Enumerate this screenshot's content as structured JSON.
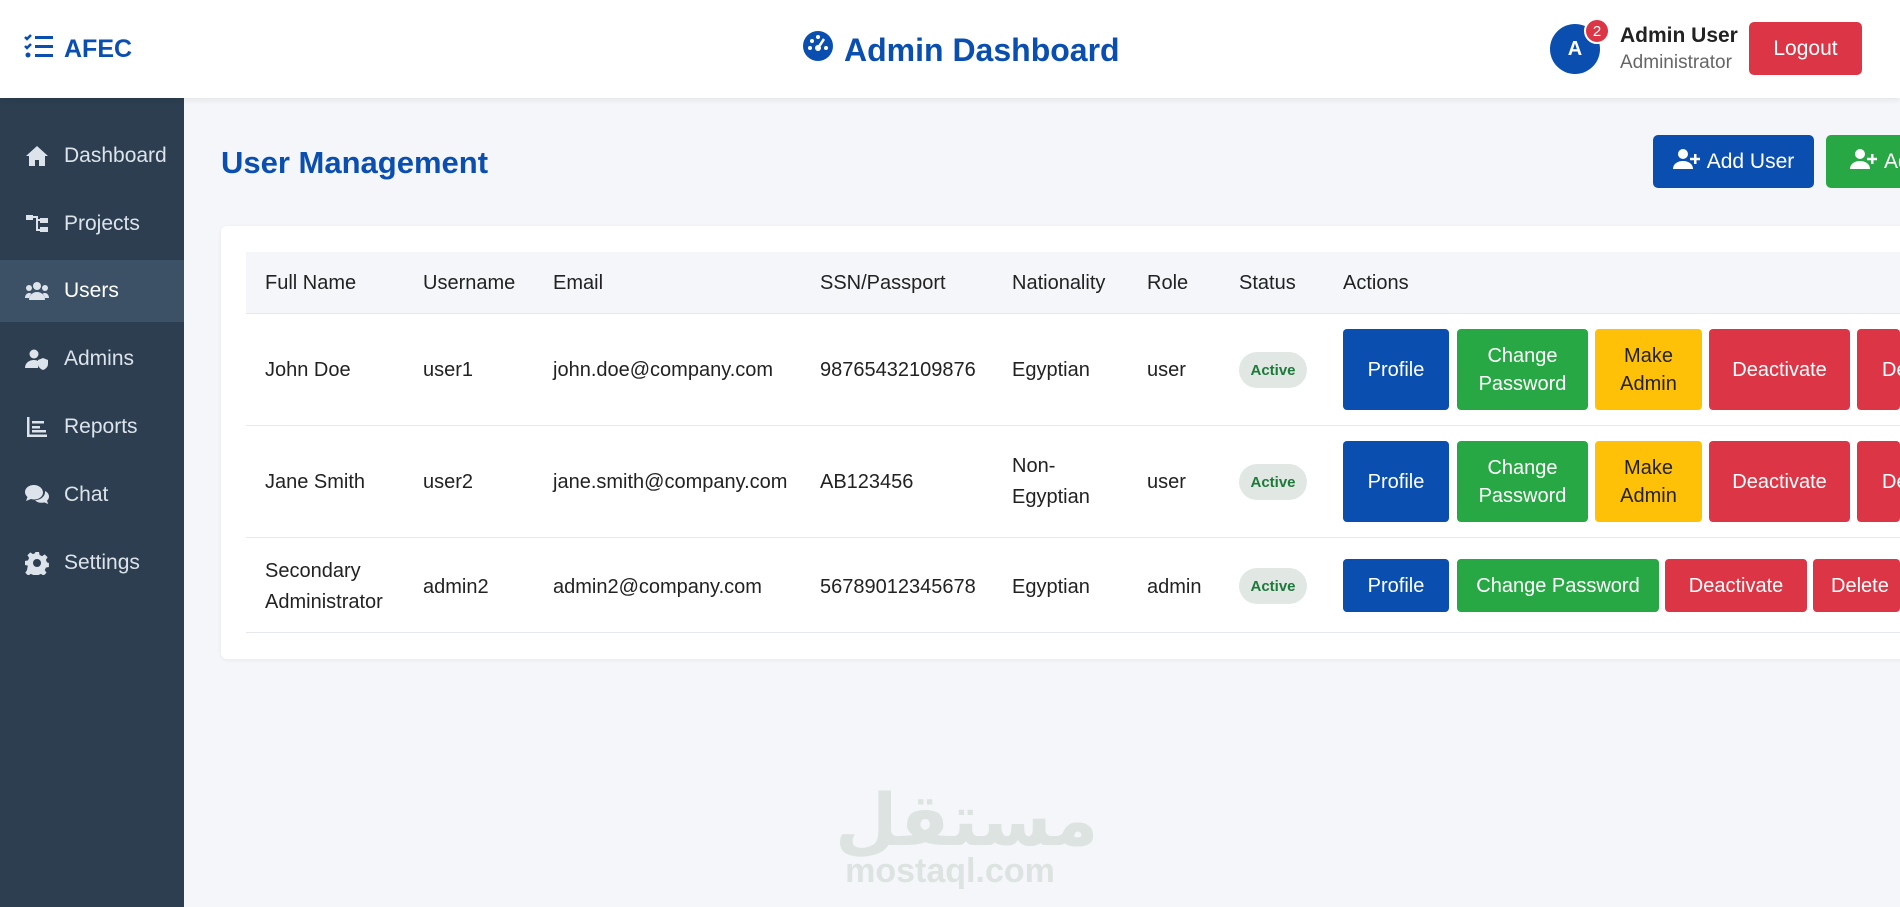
{
  "header": {
    "brand": "AFEC",
    "title": "Admin Dashboard",
    "avatar_initial": "A",
    "notification_count": "2",
    "user_name": "Admin User",
    "user_role": "Administrator",
    "logout_label": "Logout"
  },
  "sidebar": {
    "items": [
      {
        "label": "Dashboard",
        "icon": "home-icon"
      },
      {
        "label": "Projects",
        "icon": "sitemap-icon"
      },
      {
        "label": "Users",
        "icon": "users-icon",
        "active": true
      },
      {
        "label": "Admins",
        "icon": "user-shield-icon"
      },
      {
        "label": "Reports",
        "icon": "chart-icon"
      },
      {
        "label": "Chat",
        "icon": "comments-icon"
      },
      {
        "label": "Settings",
        "icon": "gear-icon"
      }
    ]
  },
  "main": {
    "title": "User Management",
    "add_user_label": "Add User",
    "add_admin_label": "Add Admin",
    "columns": [
      "Full Name",
      "Username",
      "Email",
      "SSN/Passport",
      "Nationality",
      "Role",
      "Status",
      "Actions"
    ],
    "rows": [
      {
        "full_name": "John Doe",
        "username": "user1",
        "email": "john.doe@company.com",
        "ssn": "98765432109876",
        "nationality": "Egyptian",
        "role": "user",
        "status": "Active",
        "actions": {
          "profile": "Profile",
          "change_password": "Change Password",
          "make_admin": "Make Admin",
          "deactivate": "Deactivate",
          "delete": "Delete"
        }
      },
      {
        "full_name": "Jane Smith",
        "username": "user2",
        "email": "jane.smith@company.com",
        "ssn": "AB123456",
        "nationality": "Non-Egyptian",
        "role": "user",
        "status": "Active",
        "actions": {
          "profile": "Profile",
          "change_password": "Change Password",
          "make_admin": "Make Admin",
          "deactivate": "Deactivate",
          "delete": "Delete"
        }
      },
      {
        "full_name": "Secondary Administrator",
        "username": "admin2",
        "email": "admin2@company.com",
        "ssn": "56789012345678",
        "nationality": "Egyptian",
        "role": "admin",
        "status": "Active",
        "actions": {
          "profile": "Profile",
          "change_password": "Change Password",
          "deactivate": "Deactivate",
          "delete": "Delete"
        }
      }
    ]
  },
  "watermark": {
    "arabic": "مستقل",
    "latin": "mostaql.com"
  },
  "colors": {
    "primary": "#0a4fb0",
    "success": "#28a745",
    "warning": "#ffc107",
    "danger": "#dc3545",
    "sidebar": "#2c3e50"
  }
}
